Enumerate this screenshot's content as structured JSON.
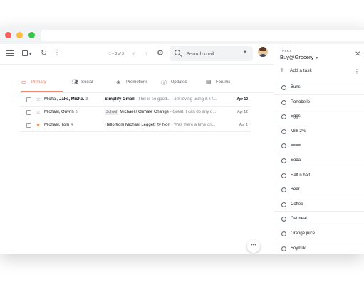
{
  "toolbar": {
    "page_count": "1 – 3 of 3",
    "search_placeholder": "Search mail"
  },
  "tabs": [
    {
      "label": "Primary",
      "icon": "inbox-icon"
    },
    {
      "label": "Social",
      "icon": "people-icon"
    },
    {
      "label": "Promotions",
      "icon": "tag-icon"
    },
    {
      "label": "Updates",
      "icon": "info-icon"
    },
    {
      "label": "Forums",
      "icon": "forum-icon"
    }
  ],
  "emails": [
    {
      "sender_a": "Micha.",
      "sender_b": "Jake, Micha.",
      "count": "3",
      "label": "",
      "subject": "Simplify Gmail",
      "snippet": " - This is so good... I am loving using it. I f...",
      "date": "Apr 12",
      "starred": false,
      "unread": true
    },
    {
      "sender_a": "Michael, Quynh",
      "sender_b": "",
      "count": "8",
      "label": "School",
      "subject": "Michael / Climate Change",
      "snippet": " - Great. I can do any d...",
      "date": "Apr 12",
      "starred": false,
      "unread": false
    },
    {
      "sender_a": "Michael, Tom",
      "sender_b": "",
      "count": "4",
      "label": "",
      "subject": "Hello from Michael Leggett @ Nori",
      "snippet": " - Was there a time on...",
      "date": "Apr 1",
      "starred": true,
      "unread": false
    }
  ],
  "fab": {
    "more_label": "•••"
  },
  "tasks": {
    "kicker": "TASKS",
    "list_name": "Buy@Grocery",
    "add_label": "Add a task",
    "items": [
      "Buns",
      "Portobello",
      "Eggs",
      "Milk 2%",
      "====",
      "Soda",
      "Half n half",
      "Beer",
      "Coffee",
      "Oatmeal",
      "Orange juice",
      "Soymilk"
    ]
  },
  "colors": {
    "primary_tab_accent": "#ef8a6d",
    "star_on": "#f4954f",
    "traffic_red": "#fc605b",
    "traffic_yellow": "#fdbc40",
    "traffic_green": "#34c84a"
  }
}
